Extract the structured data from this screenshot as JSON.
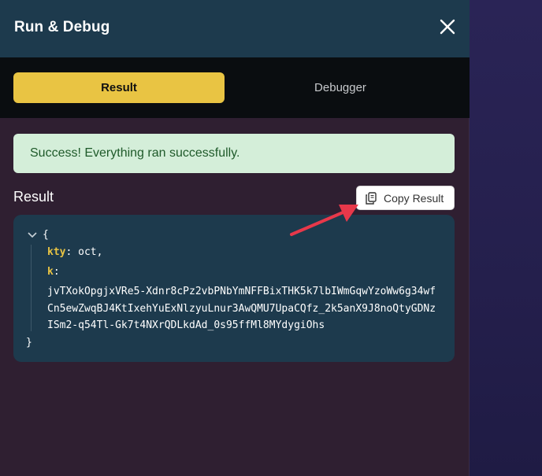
{
  "header": {
    "title": "Run & Debug"
  },
  "tabs": [
    {
      "label": "Result",
      "active": true
    },
    {
      "label": "Debugger",
      "active": false
    }
  ],
  "alert": {
    "message": "Success! Everything ran successfully."
  },
  "result": {
    "label": "Result",
    "copy_button_label": "Copy Result"
  },
  "code": {
    "open_brace": "{",
    "close_brace": "}",
    "kty_key": "kty",
    "kty_sep": ": ",
    "kty_value": "oct,",
    "k_key": "k",
    "k_sep": ":",
    "k_value": "jvTXokOpgjxVRe5-Xdnr8cPz2vbPNbYmNFFBixTHK5k7lbIWmGqwYzoWw6g34wfCn5ewZwqBJ4KtIxehYuExNlzyuLnur3AwQMU7UpaCQfz_2k5anX9J8noQtyGDNzISm2-q54Tl-Gk7t4NXrQDLkdAd_0s95ffMl8MYdygiOhs"
  },
  "colors": {
    "header_bg": "#1d3a4d",
    "tab_active_bg": "#e9c443",
    "alert_bg": "#d4eed9",
    "alert_text": "#1f5a2a",
    "code_key": "#e9c443",
    "annotation_arrow": "#e8384a"
  },
  "icons": {
    "close": "close-icon",
    "copy": "copy-icon",
    "toggle": "chevron-down-icon"
  }
}
